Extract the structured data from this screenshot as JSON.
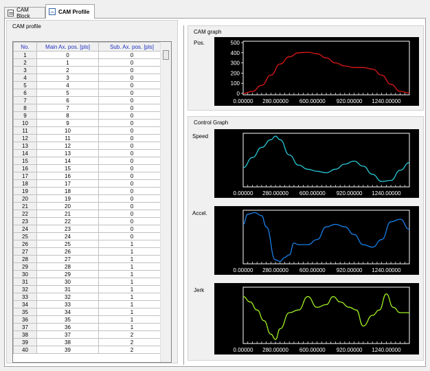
{
  "tabs": [
    {
      "label": "CAM Block",
      "icon": "block-icon",
      "active": false
    },
    {
      "label": "CAM Profile",
      "icon": "profile-chart-icon",
      "active": true
    }
  ],
  "cam_profile": {
    "title": "CAM profile",
    "columns": [
      "No.",
      "Main Ax. pos. [pls]",
      "Sub. Ax. pos. [pls]"
    ],
    "rows": [
      [
        1,
        0,
        0
      ],
      [
        2,
        1,
        0
      ],
      [
        3,
        2,
        0
      ],
      [
        4,
        3,
        0
      ],
      [
        5,
        4,
        0
      ],
      [
        6,
        5,
        0
      ],
      [
        7,
        6,
        0
      ],
      [
        8,
        7,
        0
      ],
      [
        9,
        8,
        0
      ],
      [
        10,
        9,
        0
      ],
      [
        11,
        10,
        0
      ],
      [
        12,
        11,
        0
      ],
      [
        13,
        12,
        0
      ],
      [
        14,
        13,
        0
      ],
      [
        15,
        14,
        0
      ],
      [
        16,
        15,
        0
      ],
      [
        17,
        16,
        0
      ],
      [
        18,
        17,
        0
      ],
      [
        19,
        18,
        0
      ],
      [
        20,
        19,
        0
      ],
      [
        21,
        20,
        0
      ],
      [
        22,
        21,
        0
      ],
      [
        23,
        22,
        0
      ],
      [
        24,
        23,
        0
      ],
      [
        25,
        24,
        0
      ],
      [
        26,
        25,
        1
      ],
      [
        27,
        26,
        1
      ],
      [
        28,
        27,
        1
      ],
      [
        29,
        28,
        1
      ],
      [
        30,
        29,
        1
      ],
      [
        31,
        30,
        1
      ],
      [
        32,
        31,
        1
      ],
      [
        33,
        32,
        1
      ],
      [
        34,
        33,
        1
      ],
      [
        35,
        34,
        1
      ],
      [
        36,
        35,
        1
      ],
      [
        37,
        36,
        1
      ],
      [
        38,
        37,
        2
      ],
      [
        39,
        38,
        2
      ],
      [
        40,
        39,
        2
      ]
    ]
  },
  "cam_graph": {
    "title": "CAM graph",
    "pos_label": "Pos.",
    "y_ticks": [
      "500",
      "400",
      "300",
      "200",
      "100",
      "0"
    ],
    "x_ticks": [
      "0.00000",
      "280.00000",
      "600.00000",
      "920.00000",
      "1240.00000"
    ],
    "line_color": "#e01818"
  },
  "control_graph": {
    "title": "Control Graph",
    "speed_label": "Speed",
    "accel_label": "Accel.",
    "jerk_label": "Jerk",
    "x_ticks": [
      "0.00000",
      "280.00000",
      "600.00000",
      "920.00000",
      "1240.00000"
    ],
    "speed_color": "#28c8d8",
    "accel_color": "#1880e8",
    "jerk_color": "#a0f020"
  },
  "chart_data": [
    {
      "type": "line",
      "title": "",
      "xlabel": "",
      "ylabel": "Pos.",
      "xlim": [
        0,
        1440
      ],
      "ylim": [
        0,
        500
      ],
      "series": [
        {
          "name": "",
          "x": [
            0,
            80,
            160,
            240,
            320,
            400,
            480,
            560,
            640,
            720,
            800,
            880,
            960,
            1040,
            1120,
            1200,
            1280,
            1360,
            1440
          ],
          "values": [
            0,
            20,
            80,
            180,
            290,
            360,
            400,
            405,
            390,
            350,
            300,
            270,
            255,
            255,
            240,
            180,
            90,
            20,
            5
          ]
        }
      ]
    },
    {
      "type": "line",
      "title": "",
      "xlabel": "",
      "ylabel": "Speed",
      "xlim": [
        0,
        1440
      ],
      "series": [
        {
          "name": "",
          "x": [
            0,
            80,
            160,
            240,
            280,
            320,
            400,
            480,
            560,
            640,
            720,
            800,
            880,
            960,
            1040,
            1120,
            1200,
            1280,
            1360,
            1440
          ],
          "values": [
            0.35,
            0.55,
            0.75,
            0.9,
            0.97,
            0.9,
            0.6,
            0.4,
            0.32,
            0.28,
            0.25,
            0.32,
            0.42,
            0.48,
            0.38,
            0.22,
            0.08,
            0.1,
            0.3,
            0.45
          ]
        }
      ]
    },
    {
      "type": "line",
      "title": "",
      "xlabel": "",
      "ylabel": "Accel.",
      "xlim": [
        0,
        1440
      ],
      "series": [
        {
          "name": "",
          "x": [
            0,
            40,
            100,
            160,
            200,
            280,
            320,
            360,
            400,
            440,
            480,
            560,
            640,
            720,
            800,
            880,
            960,
            1040,
            1120,
            1200,
            1280,
            1360,
            1440
          ],
          "values": [
            0.75,
            0.95,
            0.98,
            0.92,
            0.7,
            0.05,
            0.02,
            0.1,
            0.15,
            0.38,
            0.35,
            0.35,
            0.45,
            0.7,
            0.75,
            0.7,
            0.55,
            0.35,
            0.3,
            0.45,
            0.8,
            0.85,
            0.65
          ]
        }
      ]
    },
    {
      "type": "line",
      "title": "",
      "xlabel": "",
      "ylabel": "Jerk",
      "xlim": [
        0,
        1440
      ],
      "series": [
        {
          "name": "",
          "x": [
            0,
            60,
            120,
            180,
            240,
            280,
            320,
            400,
            480,
            560,
            640,
            720,
            780,
            840,
            920,
            980,
            1040,
            1120,
            1180,
            1240,
            1300,
            1360,
            1440
          ],
          "values": [
            0.85,
            0.75,
            0.6,
            0.4,
            0.15,
            0.05,
            0.25,
            0.55,
            0.6,
            0.85,
            0.65,
            0.7,
            0.85,
            0.75,
            0.65,
            0.6,
            0.3,
            0.5,
            0.6,
            0.9,
            0.65,
            0.55,
            0.55
          ]
        }
      ]
    }
  ]
}
